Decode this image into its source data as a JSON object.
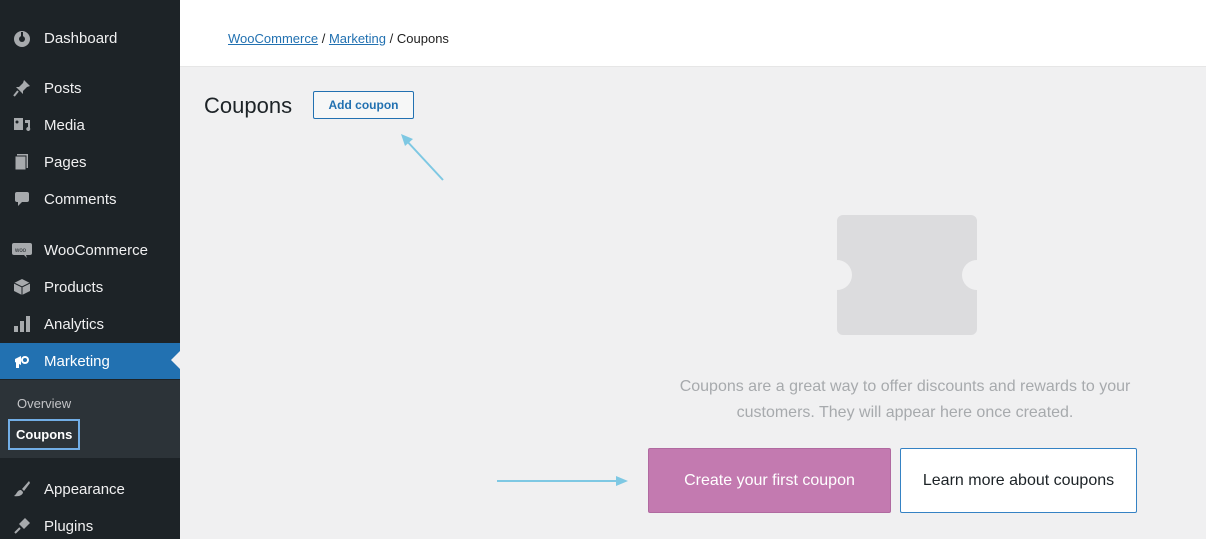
{
  "sidebar": {
    "items": [
      {
        "label": "Dashboard",
        "icon": "dashboard-icon"
      },
      {
        "label": "Posts",
        "icon": "pin-icon"
      },
      {
        "label": "Media",
        "icon": "media-icon"
      },
      {
        "label": "Pages",
        "icon": "pages-icon"
      },
      {
        "label": "Comments",
        "icon": "comment-icon"
      },
      {
        "label": "WooCommerce",
        "icon": "woo-icon"
      },
      {
        "label": "Products",
        "icon": "box-icon"
      },
      {
        "label": "Analytics",
        "icon": "bar-chart-icon"
      },
      {
        "label": "Marketing",
        "icon": "megaphone-icon",
        "active": true
      },
      {
        "label": "Appearance",
        "icon": "brush-icon"
      },
      {
        "label": "Plugins",
        "icon": "plug-icon"
      }
    ],
    "submenu": [
      {
        "label": "Overview"
      },
      {
        "label": "Coupons",
        "current": true
      }
    ]
  },
  "breadcrumb": {
    "items": [
      "WooCommerce",
      "Marketing",
      "Coupons"
    ],
    "separator": "/"
  },
  "page": {
    "title": "Coupons",
    "add_button": "Add coupon"
  },
  "empty_state": {
    "icon": "coupon-ticket-icon",
    "message_line1": "Coupons are a great way to offer discounts and rewards to your",
    "message_line2": "customers. They will appear here once created.",
    "primary_button": "Create your first coupon",
    "secondary_button": "Learn more about coupons"
  },
  "colors": {
    "sidebar_bg": "#1d2327",
    "active_blue": "#2271b1",
    "primary_button": "#c37ab0",
    "annotation_arrow": "#7ec8e3"
  }
}
